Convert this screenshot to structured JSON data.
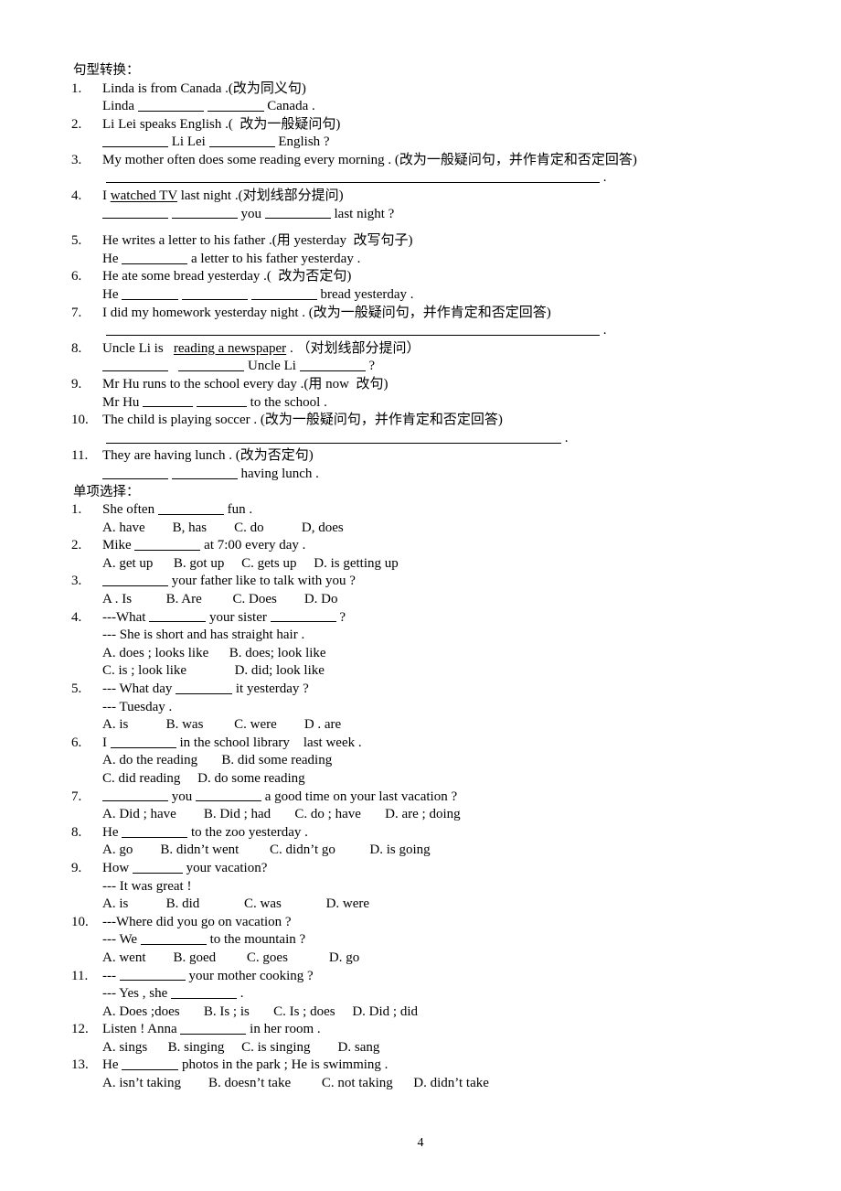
{
  "page": {
    "page_number": "4"
  },
  "section1": {
    "heading": "句型转换：",
    "items": [
      {
        "num": "1.",
        "lines": [
          {
            "type": "prompt",
            "text": "Linda is from Canada .(改为同义句)"
          },
          {
            "type": "answer",
            "parts": [
              "Linda ",
              "BLANK2",
              " ",
              "BLANK1",
              " Canada ."
            ]
          }
        ]
      },
      {
        "num": "2.",
        "lines": [
          {
            "type": "prompt",
            "text": "Li Lei speaks English .(  改为一般疑问句)"
          },
          {
            "type": "answer",
            "parts": [
              "",
              "BLANK2",
              " Li Lei ",
              "BLANK2",
              " English ?"
            ]
          }
        ]
      },
      {
        "num": "3.",
        "lines": [
          {
            "type": "prompt",
            "text": "My mother often does some reading every morning . (改为一般疑问句，并作肯定和否定回答)"
          },
          {
            "type": "answer_long",
            "text": "."
          }
        ]
      },
      {
        "num": "4.",
        "lines": [
          {
            "type": "prompt_underlined",
            "pre": "I ",
            "underlined": "watched TV",
            "post": " last night .(对划线部分提问)"
          },
          {
            "type": "answer",
            "parts": [
              "",
              "BLANK2",
              " ",
              "BLANK2",
              " you ",
              "BLANK2",
              " last night ?"
            ]
          }
        ]
      },
      {
        "num": "5.",
        "lines": [
          {
            "type": "prompt",
            "text": "He writes a letter to his father .(用 yesterday  改写句子)"
          },
          {
            "type": "answer",
            "parts": [
              "He ",
              "BLANK2",
              " a letter to his father yesterday ."
            ]
          }
        ]
      },
      {
        "num": "6.",
        "lines": [
          {
            "type": "prompt",
            "text": "He ate some bread yesterday .(  改为否定句)"
          },
          {
            "type": "answer",
            "parts": [
              "He ",
              "BLANK1",
              " ",
              "BLANK2",
              " ",
              "BLANK2",
              " bread yesterday ."
            ]
          }
        ]
      },
      {
        "num": "7.",
        "lines": [
          {
            "type": "prompt",
            "text": "I did my homework yesterday night . (改为一般疑问句，并作肯定和否定回答)"
          },
          {
            "type": "answer_long",
            "text": "."
          }
        ]
      },
      {
        "num": "8.",
        "lines": [
          {
            "type": "prompt_underlined",
            "pre": "Uncle Li is   ",
            "underlined": "reading a newspaper",
            "post": " . （对划线部分提问）"
          },
          {
            "type": "answer",
            "parts": [
              "",
              "BLANK2",
              "   ",
              "BLANK2",
              " Uncle Li ",
              "BLANK2",
              " ?"
            ]
          }
        ]
      },
      {
        "num": "9.",
        "lines": [
          {
            "type": "prompt",
            "text": "Mr Hu runs to the school every day .(用 now  改句)"
          },
          {
            "type": "answer",
            "parts": [
              "Mr Hu ",
              "BLANK1",
              " ",
              "BLANK1",
              " to the school ."
            ]
          }
        ]
      },
      {
        "num": "10.",
        "lines": [
          {
            "type": "prompt",
            "text": "The child is playing soccer . (改为一般疑问句，并作肯定和否定回答)"
          },
          {
            "type": "answer_long2",
            "text": "."
          }
        ]
      },
      {
        "num": "11.",
        "lines": [
          {
            "type": "prompt",
            "text": "They are having lunch . (改为否定句)"
          },
          {
            "type": "answer",
            "parts": [
              "",
              "BLANK2",
              " ",
              "BLANK2",
              " having lunch ."
            ]
          }
        ]
      }
    ]
  },
  "section2": {
    "heading": "单项选择：",
    "items": [
      {
        "num": "1.",
        "stem_parts": [
          "She often ",
          "BLANK2",
          " fun ."
        ],
        "options": "A. have        B, has        C. do           D, does"
      },
      {
        "num": "2.",
        "stem_parts": [
          "Mike ",
          "BLANK2",
          " at 7:00 every day ."
        ],
        "options": "A. get up      B. got up     C. gets up     D. is getting up"
      },
      {
        "num": "3.",
        "stem_parts": [
          "",
          "BLANK2",
          " your father like to talk with you ?"
        ],
        "options": "A . Is          B. Are         C. Does        D. Do"
      },
      {
        "num": "4.",
        "stem_parts": [
          "---What ",
          "BLANK1",
          " your sister ",
          "BLANK2",
          " ?"
        ],
        "extra_line": "--- She is short and has straight hair .",
        "options_line1": "A. does ; looks like      B. does; look like",
        "options_line2": "C. is ; look like              D. did; look like"
      },
      {
        "num": "5.",
        "stem_parts": [
          "--- What day ",
          "BLANK1",
          " it yesterday ?"
        ],
        "extra_line": "--- Tuesday .",
        "options": "A. is           B. was         C. were        D . are"
      },
      {
        "num": "6.",
        "stem_parts": [
          "I ",
          "BLANK2",
          " in the school library    last week ."
        ],
        "options_line1": "A. do the reading       B. did some reading",
        "options_line2": "C. did reading     D. do some reading"
      },
      {
        "num": "7.",
        "stem_parts": [
          "",
          "BLANK2",
          " you ",
          "BLANK2",
          " a good time on your last vacation ?"
        ],
        "options": "A. Did ; have        B. Did ; had       C. do ; have       D. are ; doing"
      },
      {
        "num": "8.",
        "stem_parts": [
          "He ",
          "BLANK2",
          " to the zoo yesterday ."
        ],
        "options": "A. go        B. didn’t went         C. didn’t go          D. is going"
      },
      {
        "num": "9.",
        "stem_parts": [
          "How ",
          "BLANK1",
          " your vacation?"
        ],
        "extra_line": "--- It was great !",
        "options": "A. is           B. did             C. was             D. were"
      },
      {
        "num": "10.",
        "stem_parts": [
          "---Where did you go on vacation ?"
        ],
        "extra_line_parts": [
          "--- We ",
          "BLANK2",
          " to the mountain ?"
        ],
        "options": "A. went        B. goed         C. goes            D. go"
      },
      {
        "num": "11.",
        "stem_parts": [
          "--- ",
          "BLANK2",
          " your mother cooking ?"
        ],
        "extra_line_parts": [
          "--- Yes , she ",
          "BLANK2",
          " ."
        ],
        "options": "A. Does ;does       B. Is ; is       C. Is ; does     D. Did ; did"
      },
      {
        "num": "12.",
        "stem_parts": [
          "Listen ! Anna ",
          "BLANK2",
          " in her room ."
        ],
        "options": "A. sings      B. singing     C. is singing        D. sang"
      },
      {
        "num": "13.",
        "stem_parts": [
          "He ",
          "BLANK1",
          " photos in the park ; He is swimming ."
        ],
        "options": "A. isn’t taking        B. doesn’t take         C. not taking      D. didn’t take"
      }
    ]
  }
}
